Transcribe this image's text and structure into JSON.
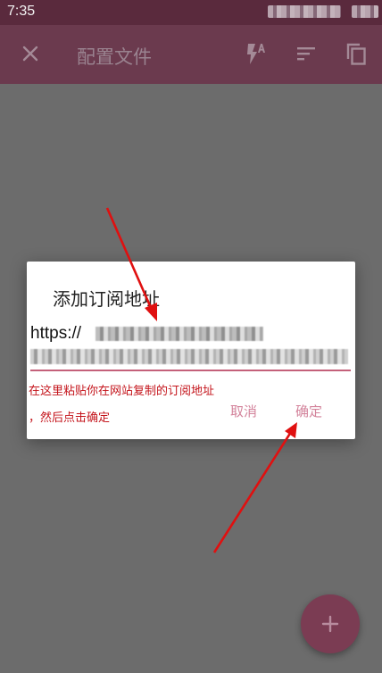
{
  "status_bar": {
    "time": "7:35"
  },
  "app_bar": {
    "title": "配置文件",
    "icons": [
      "close-icon",
      "flash-auto-icon",
      "sort-icon",
      "copy-icon"
    ]
  },
  "dialog": {
    "title": "添加订阅地址",
    "url_prefix": "https://",
    "cancel_label": "取消",
    "ok_label": "确定"
  },
  "annotation": {
    "line1": "在这里粘贴你在网站复制的订阅地址",
    "line2": "，然后点击确定"
  },
  "fab": {
    "icon": "plus-icon"
  },
  "colors": {
    "status_bar": "#5a2a3d",
    "app_bar": "#6b3a4e",
    "accent": "#c4617a",
    "button_text": "#d3839b",
    "annotation": "#c4141b",
    "fab": "#7b3c53",
    "scrim": "#6c6c6c"
  }
}
